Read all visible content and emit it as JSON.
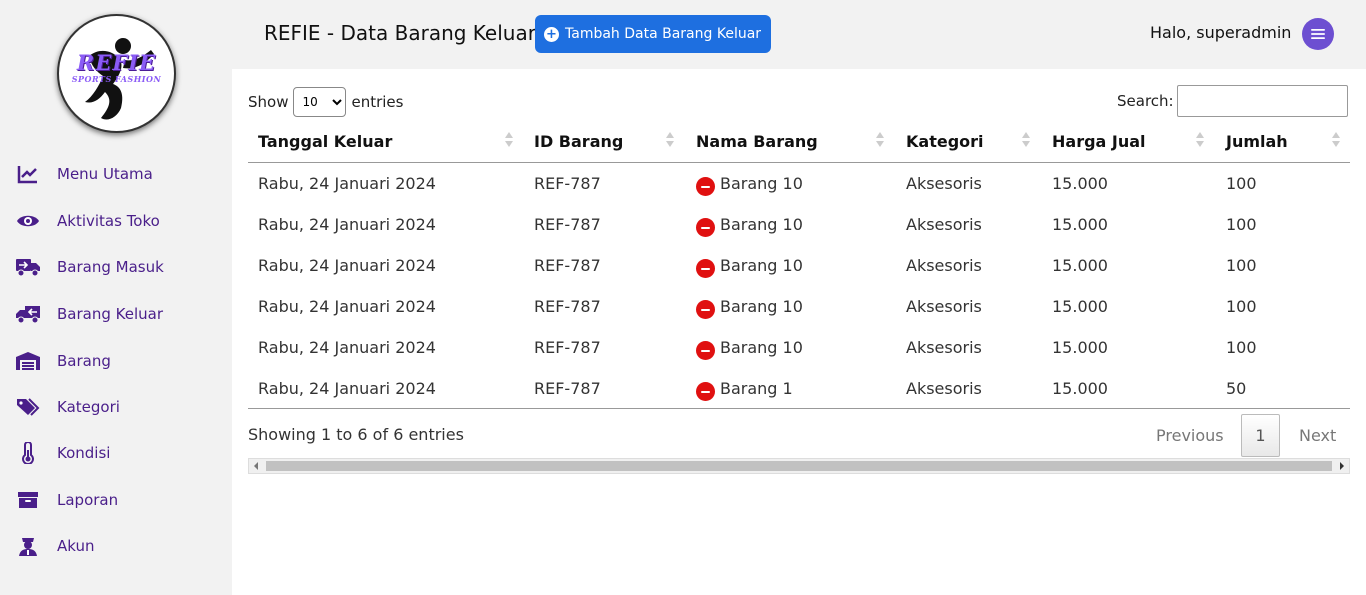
{
  "app": {
    "title": "REFIE - Data Barang Keluar",
    "add_button_label": "Tambah Data Barang Keluar",
    "greeting": "Halo, superadmin",
    "brand_color": "#4a1f8a",
    "accent_color": "#1e6fe0"
  },
  "logo": {
    "main_text": "REFIE",
    "sub_text": "SPORTS FASHION"
  },
  "sidebar": {
    "items": [
      {
        "label": "Menu Utama",
        "icon": "chart-line-icon"
      },
      {
        "label": "Aktivitas Toko",
        "icon": "eye-icon"
      },
      {
        "label": "Barang Masuk",
        "icon": "truck-in-icon"
      },
      {
        "label": "Barang Keluar",
        "icon": "truck-out-icon"
      },
      {
        "label": "Barang",
        "icon": "warehouse-icon"
      },
      {
        "label": "Kategori",
        "icon": "tags-icon"
      },
      {
        "label": "Kondisi",
        "icon": "thermometer-icon"
      },
      {
        "label": "Laporan",
        "icon": "archive-icon"
      },
      {
        "label": "Akun",
        "icon": "user-icon"
      }
    ]
  },
  "table_controls": {
    "show_label": "Show",
    "entries_label": "entries",
    "page_length": "10",
    "search_label": "Search:",
    "search_value": ""
  },
  "table": {
    "columns": [
      "Tanggal Keluar",
      "ID Barang",
      "Nama Barang",
      "Kategori",
      "Harga Jual",
      "Jumlah"
    ],
    "rows": [
      [
        "Rabu, 24 Januari 2024",
        "REF-787",
        "Barang 10",
        "Aksesoris",
        "15.000",
        "100"
      ],
      [
        "Rabu, 24 Januari 2024",
        "REF-787",
        "Barang 10",
        "Aksesoris",
        "15.000",
        "100"
      ],
      [
        "Rabu, 24 Januari 2024",
        "REF-787",
        "Barang 10",
        "Aksesoris",
        "15.000",
        "100"
      ],
      [
        "Rabu, 24 Januari 2024",
        "REF-787",
        "Barang 10",
        "Aksesoris",
        "15.000",
        "100"
      ],
      [
        "Rabu, 24 Januari 2024",
        "REF-787",
        "Barang 10",
        "Aksesoris",
        "15.000",
        "100"
      ],
      [
        "Rabu, 24 Januari 2024",
        "REF-787",
        "Barang 1",
        "Aksesoris",
        "15.000",
        "50"
      ]
    ]
  },
  "footer": {
    "info": "Showing 1 to 6 of 6 entries",
    "previous": "Previous",
    "current_page": "1",
    "next": "Next"
  }
}
